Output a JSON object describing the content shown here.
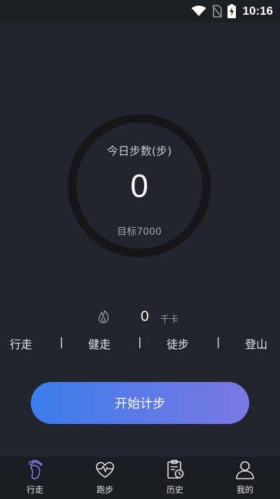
{
  "status_bar": {
    "time": "10:16",
    "icons": [
      "wifi-icon",
      "no-sim-icon",
      "battery-charging-icon"
    ]
  },
  "steps": {
    "title": "今日步数(步)",
    "value": "0",
    "goal_label": "目标7000"
  },
  "calories": {
    "icon": "flame-icon",
    "value": "0",
    "unit": "千卡"
  },
  "modes": {
    "walk": "行走",
    "brisk": "健走",
    "hike": "徒步",
    "climb": "登山",
    "separator": "|"
  },
  "start_button": {
    "label": "开始计步"
  },
  "tabs": [
    {
      "label": "行走",
      "icon": "footprint-icon",
      "active": true
    },
    {
      "label": "跑步",
      "icon": "heart-pulse-icon",
      "active": false
    },
    {
      "label": "历史",
      "icon": "history-clipboard-icon",
      "active": false
    },
    {
      "label": "我的",
      "icon": "profile-icon",
      "active": false
    }
  ],
  "colors": {
    "background": "#23232d",
    "ring": "#161619",
    "accent_start": "#3a7dec",
    "accent_end": "#7c78e2",
    "active_tab_icon": "#8b7fe8"
  }
}
